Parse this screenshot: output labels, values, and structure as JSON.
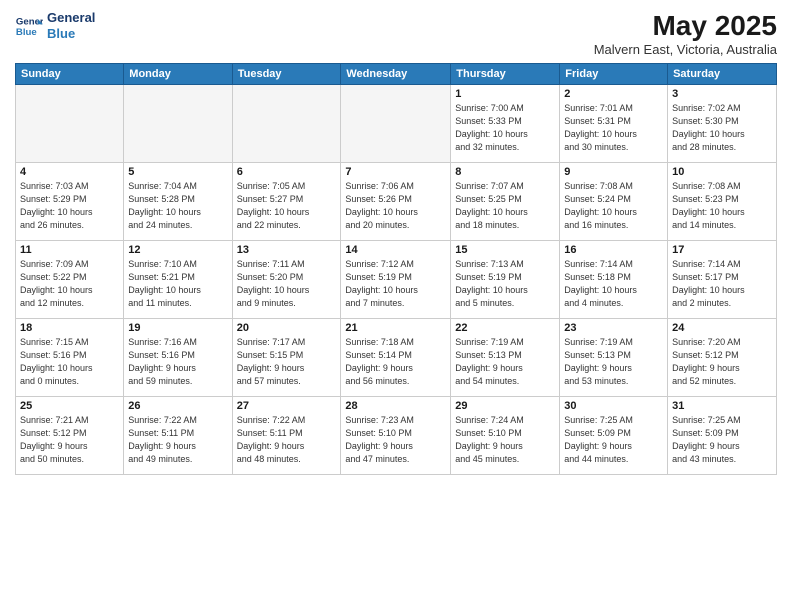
{
  "header": {
    "logo_line1": "General",
    "logo_line2": "Blue",
    "month": "May 2025",
    "location": "Malvern East, Victoria, Australia"
  },
  "weekdays": [
    "Sunday",
    "Monday",
    "Tuesday",
    "Wednesday",
    "Thursday",
    "Friday",
    "Saturday"
  ],
  "weeks": [
    [
      {
        "day": "",
        "info": ""
      },
      {
        "day": "",
        "info": ""
      },
      {
        "day": "",
        "info": ""
      },
      {
        "day": "",
        "info": ""
      },
      {
        "day": "1",
        "info": "Sunrise: 7:00 AM\nSunset: 5:33 PM\nDaylight: 10 hours\nand 32 minutes."
      },
      {
        "day": "2",
        "info": "Sunrise: 7:01 AM\nSunset: 5:31 PM\nDaylight: 10 hours\nand 30 minutes."
      },
      {
        "day": "3",
        "info": "Sunrise: 7:02 AM\nSunset: 5:30 PM\nDaylight: 10 hours\nand 28 minutes."
      }
    ],
    [
      {
        "day": "4",
        "info": "Sunrise: 7:03 AM\nSunset: 5:29 PM\nDaylight: 10 hours\nand 26 minutes."
      },
      {
        "day": "5",
        "info": "Sunrise: 7:04 AM\nSunset: 5:28 PM\nDaylight: 10 hours\nand 24 minutes."
      },
      {
        "day": "6",
        "info": "Sunrise: 7:05 AM\nSunset: 5:27 PM\nDaylight: 10 hours\nand 22 minutes."
      },
      {
        "day": "7",
        "info": "Sunrise: 7:06 AM\nSunset: 5:26 PM\nDaylight: 10 hours\nand 20 minutes."
      },
      {
        "day": "8",
        "info": "Sunrise: 7:07 AM\nSunset: 5:25 PM\nDaylight: 10 hours\nand 18 minutes."
      },
      {
        "day": "9",
        "info": "Sunrise: 7:08 AM\nSunset: 5:24 PM\nDaylight: 10 hours\nand 16 minutes."
      },
      {
        "day": "10",
        "info": "Sunrise: 7:08 AM\nSunset: 5:23 PM\nDaylight: 10 hours\nand 14 minutes."
      }
    ],
    [
      {
        "day": "11",
        "info": "Sunrise: 7:09 AM\nSunset: 5:22 PM\nDaylight: 10 hours\nand 12 minutes."
      },
      {
        "day": "12",
        "info": "Sunrise: 7:10 AM\nSunset: 5:21 PM\nDaylight: 10 hours\nand 11 minutes."
      },
      {
        "day": "13",
        "info": "Sunrise: 7:11 AM\nSunset: 5:20 PM\nDaylight: 10 hours\nand 9 minutes."
      },
      {
        "day": "14",
        "info": "Sunrise: 7:12 AM\nSunset: 5:19 PM\nDaylight: 10 hours\nand 7 minutes."
      },
      {
        "day": "15",
        "info": "Sunrise: 7:13 AM\nSunset: 5:19 PM\nDaylight: 10 hours\nand 5 minutes."
      },
      {
        "day": "16",
        "info": "Sunrise: 7:14 AM\nSunset: 5:18 PM\nDaylight: 10 hours\nand 4 minutes."
      },
      {
        "day": "17",
        "info": "Sunrise: 7:14 AM\nSunset: 5:17 PM\nDaylight: 10 hours\nand 2 minutes."
      }
    ],
    [
      {
        "day": "18",
        "info": "Sunrise: 7:15 AM\nSunset: 5:16 PM\nDaylight: 10 hours\nand 0 minutes."
      },
      {
        "day": "19",
        "info": "Sunrise: 7:16 AM\nSunset: 5:16 PM\nDaylight: 9 hours\nand 59 minutes."
      },
      {
        "day": "20",
        "info": "Sunrise: 7:17 AM\nSunset: 5:15 PM\nDaylight: 9 hours\nand 57 minutes."
      },
      {
        "day": "21",
        "info": "Sunrise: 7:18 AM\nSunset: 5:14 PM\nDaylight: 9 hours\nand 56 minutes."
      },
      {
        "day": "22",
        "info": "Sunrise: 7:19 AM\nSunset: 5:13 PM\nDaylight: 9 hours\nand 54 minutes."
      },
      {
        "day": "23",
        "info": "Sunrise: 7:19 AM\nSunset: 5:13 PM\nDaylight: 9 hours\nand 53 minutes."
      },
      {
        "day": "24",
        "info": "Sunrise: 7:20 AM\nSunset: 5:12 PM\nDaylight: 9 hours\nand 52 minutes."
      }
    ],
    [
      {
        "day": "25",
        "info": "Sunrise: 7:21 AM\nSunset: 5:12 PM\nDaylight: 9 hours\nand 50 minutes."
      },
      {
        "day": "26",
        "info": "Sunrise: 7:22 AM\nSunset: 5:11 PM\nDaylight: 9 hours\nand 49 minutes."
      },
      {
        "day": "27",
        "info": "Sunrise: 7:22 AM\nSunset: 5:11 PM\nDaylight: 9 hours\nand 48 minutes."
      },
      {
        "day": "28",
        "info": "Sunrise: 7:23 AM\nSunset: 5:10 PM\nDaylight: 9 hours\nand 47 minutes."
      },
      {
        "day": "29",
        "info": "Sunrise: 7:24 AM\nSunset: 5:10 PM\nDaylight: 9 hours\nand 45 minutes."
      },
      {
        "day": "30",
        "info": "Sunrise: 7:25 AM\nSunset: 5:09 PM\nDaylight: 9 hours\nand 44 minutes."
      },
      {
        "day": "31",
        "info": "Sunrise: 7:25 AM\nSunset: 5:09 PM\nDaylight: 9 hours\nand 43 minutes."
      }
    ]
  ]
}
